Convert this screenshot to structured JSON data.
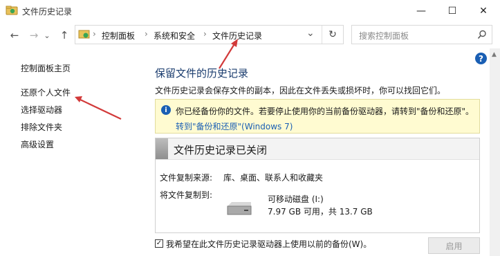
{
  "window": {
    "title": "文件历史记录"
  },
  "window_controls": {
    "minimize": "—",
    "maximize": "☐",
    "close": "✕"
  },
  "nav": {
    "back": "←",
    "forward": "→",
    "up": "↑",
    "dropdown": "⌄",
    "refresh": "↻",
    "breadcrumb": [
      "控制面板",
      "系统和安全",
      "文件历史记录"
    ],
    "separator": "›"
  },
  "search": {
    "placeholder": "搜索控制面板",
    "icon": "search-icon"
  },
  "left_nav": {
    "home": "控制面板主页",
    "items": [
      "还原个人文件",
      "选择驱动器",
      "排除文件夹",
      "高级设置"
    ]
  },
  "main": {
    "title": "保留文件的历史记录",
    "description": "文件历史记录会保存文件的副本，因此在文件丢失或损坏时，你可以找回它们。",
    "info": {
      "text": "你已经备份你的文件。若要停止使用你的当前备份驱动器，请转到\"备份和还原\"。",
      "link": "转到\"备份和还原\"(Windows 7)"
    },
    "status": {
      "title": "文件历史记录已关闭",
      "source_label": "文件复制来源:",
      "source_value": "库、桌面、联系人和收藏夹",
      "dest_label": "将文件复制到:",
      "drive_name": "可移动磁盘 (I:)",
      "drive_space": "7.97 GB 可用，共 13.7 GB"
    },
    "checkbox_label": "我希望在此文件历史记录驱动器上使用以前的备份(W)。",
    "checkbox_checked": true,
    "enable_button": "启用"
  },
  "colors": {
    "accent": "#1a5fb4",
    "annotation": "#d23a3a",
    "info_bg": "#fffbd1"
  }
}
